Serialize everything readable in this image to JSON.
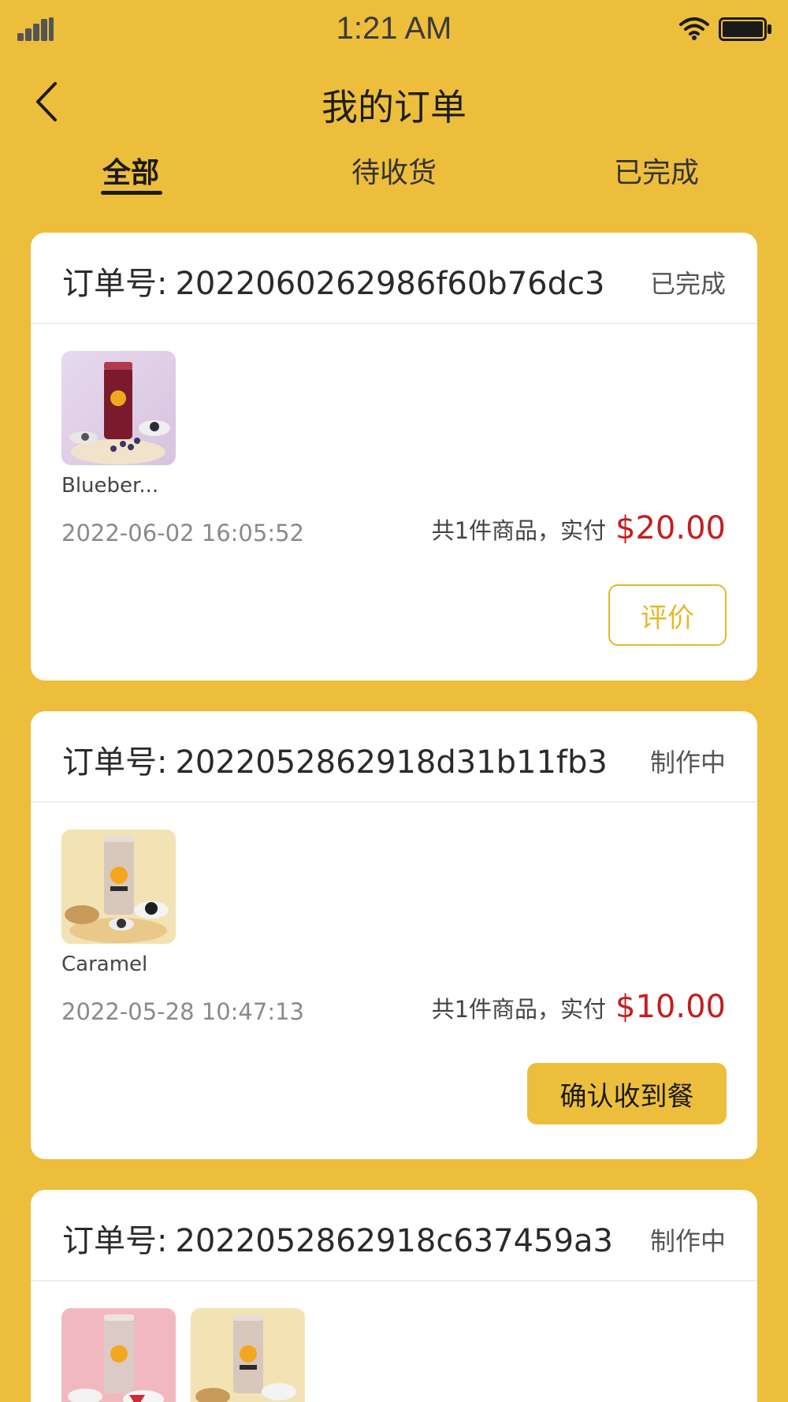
{
  "status_bar": {
    "time": "1:21 AM"
  },
  "header": {
    "title": "我的订单"
  },
  "tabs": [
    {
      "label": "全部",
      "active": true
    },
    {
      "label": "待收货",
      "active": false
    },
    {
      "label": "已完成",
      "active": false
    }
  ],
  "orders": [
    {
      "order_label": "订单号:",
      "order_no": "2022060262986f60b76dc3",
      "status": "已完成",
      "products": [
        "Blueber..."
      ],
      "date": "2022-06-02 16:05:52",
      "summary": "共1件商品，实付",
      "price": "$20.00",
      "action": "评价"
    },
    {
      "order_label": "订单号:",
      "order_no": "2022052862918d31b11fb3",
      "status": "制作中",
      "products": [
        "Caramel"
      ],
      "date": "2022-05-28 10:47:13",
      "summary": "共1件商品，实付",
      "price": "$10.00",
      "action": "确认收到餐"
    },
    {
      "order_label": "订单号:",
      "order_no": "2022052862918c637459a3",
      "status": "制作中"
    }
  ],
  "colors": {
    "background": "#EDBE3C",
    "price": "#C41E1E",
    "accent": "#E3B92A"
  }
}
